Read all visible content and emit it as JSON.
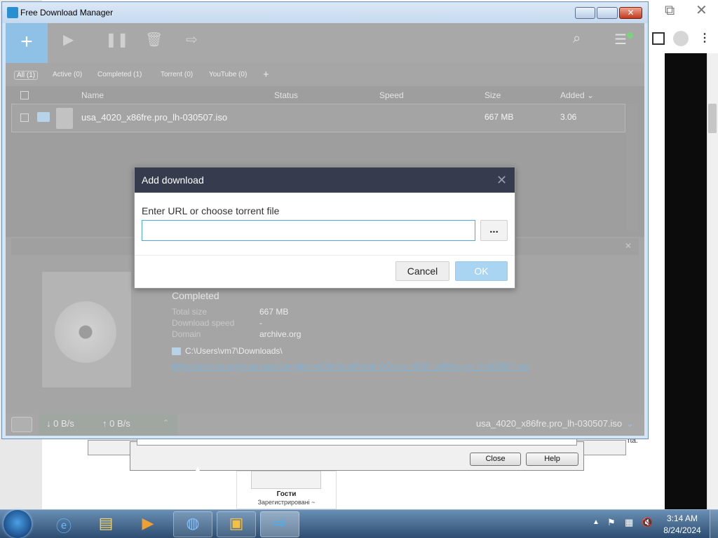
{
  "app": {
    "title": "Free Download Manager"
  },
  "toolbar": {
    "add": "+",
    "search_icon": "search-icon",
    "menu_icon": "menu-icon"
  },
  "tabs": [
    {
      "label": "All (1)",
      "active": true
    },
    {
      "label": "Active (0)",
      "active": false
    },
    {
      "label": "Completed (1)",
      "active": false
    },
    {
      "label": "Torrent (0)",
      "active": false
    },
    {
      "label": "YouTube (0)",
      "active": false
    },
    {
      "label": "+",
      "active": false
    }
  ],
  "list": {
    "columns": [
      "Name",
      "Status",
      "Speed",
      "Size",
      "Added ⌄"
    ],
    "rows": [
      {
        "name": "usa_4020_x86fre.pro_lh-030507.iso",
        "status": "",
        "speed": "",
        "size": "667 MB",
        "added": "3.06"
      }
    ]
  },
  "details": {
    "status": "Completed",
    "total_size_label": "Total size",
    "total_size_value": "667 MB",
    "download_speed_label": "Download speed",
    "download_speed_value": "-",
    "domain_label": "Domain",
    "domain_value": "archive.org",
    "folder_path": "C:\\Users\\vm7\\Downloads\\",
    "url": "https://archive.org/download/Longhorn4020-BootFixed-ISO/usa_4020_x86fre.pro_lh-030507.iso"
  },
  "statusbar": {
    "down_speed": "↓ 0 B/s",
    "up_speed": "↑ 0 B/s",
    "current_file": "usa_4020_x86fre.pro_lh-030507.iso"
  },
  "dialog": {
    "title": "Add download",
    "label": "Enter URL or choose torrent file",
    "input_value": "",
    "browse_label": "...",
    "cancel_label": "Cancel",
    "ok_label": "OK"
  },
  "background": {
    "close_label": "Close",
    "help_label": "Help",
    "guest_title": "Гости",
    "guest_subtitle": "Зарегистрировані ~",
    "right_text": "тta."
  },
  "taskbar": {
    "time": "3:14 AM",
    "date": "8/24/2024"
  },
  "colors": {
    "toolbar_bg": "#a8a8a8",
    "add_button": "#8fc1e6",
    "dialog_header": "#363b4e",
    "ok_button": "#a9d4f2",
    "input_border": "#4ea8de",
    "link": "#7fb2d6"
  }
}
